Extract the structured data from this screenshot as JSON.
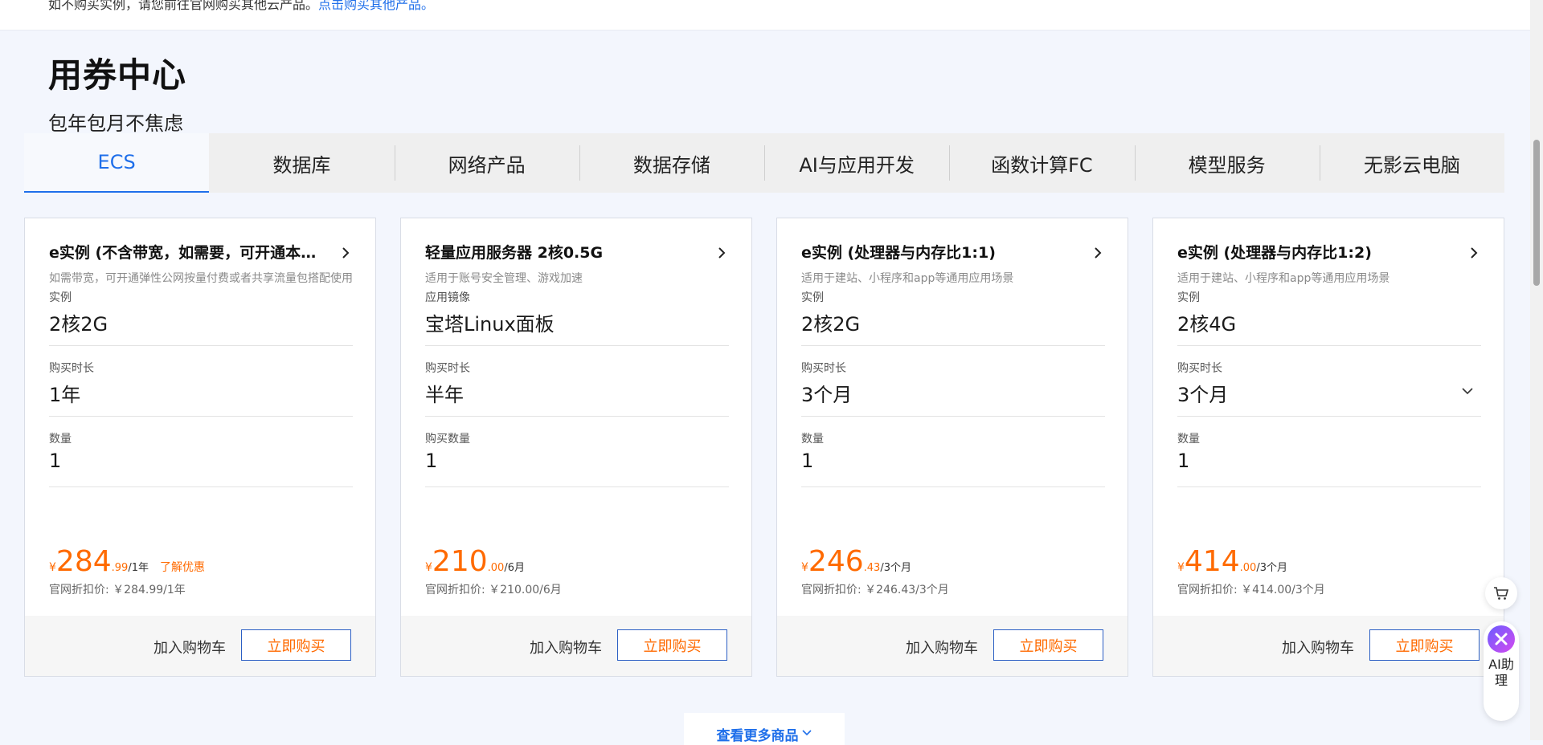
{
  "notice": {
    "text": "如不购买实例，请您前往官网购买其他云产品。",
    "link": "点击购买其他产品。"
  },
  "header": {
    "title": "用券中心",
    "subtitle": "包年包月不焦虑"
  },
  "tabs": [
    {
      "label": "ECS",
      "active": true
    },
    {
      "label": "数据库"
    },
    {
      "label": "网络产品"
    },
    {
      "label": "数据存储"
    },
    {
      "label": "AI与应用开发"
    },
    {
      "label": "函数计算FC"
    },
    {
      "label": "模型服务"
    },
    {
      "label": "无影云电脑"
    }
  ],
  "cards": [
    {
      "title": "e实例 (不含带宽，如需要，可开通本地公网)",
      "desc": "如需带宽，可开通弹性公网按量付费或者共享流量包搭配使用",
      "fields": [
        {
          "label": "实例",
          "value": "2核2G"
        },
        {
          "label": "购买时长",
          "value": "1年"
        },
        {
          "label": "数量",
          "value": "1"
        }
      ],
      "price": {
        "currency": "¥",
        "int": "284",
        "dec": ".99",
        "unit": "/1年"
      },
      "promo": "了解优惠",
      "ref_price": "官网折扣价: ￥284.99/1年",
      "add_cart": "加入购物车",
      "buy": "立即购买"
    },
    {
      "title": "轻量应用服务器 2核0.5G",
      "desc": "适用于账号安全管理、游戏加速",
      "fields": [
        {
          "label": "应用镜像",
          "value": "宝塔Linux面板"
        },
        {
          "label": "购买时长",
          "value": "半年"
        },
        {
          "label": "购买数量",
          "value": "1"
        }
      ],
      "price": {
        "currency": "¥",
        "int": "210",
        "dec": ".00",
        "unit": "/6月"
      },
      "ref_price": "官网折扣价: ￥210.00/6月",
      "add_cart": "加入购物车",
      "buy": "立即购买"
    },
    {
      "title": "e实例 (处理器与内存比1:1)",
      "desc": "适用于建站、小程序和app等通用应用场景",
      "fields": [
        {
          "label": "实例",
          "value": "2核2G"
        },
        {
          "label": "购买时长",
          "value": "3个月"
        },
        {
          "label": "数量",
          "value": "1"
        }
      ],
      "price": {
        "currency": "¥",
        "int": "246",
        "dec": ".43",
        "unit": "/3个月"
      },
      "ref_price": "官网折扣价: ￥246.43/3个月",
      "add_cart": "加入购物车",
      "buy": "立即购买"
    },
    {
      "title": "e实例 (处理器与内存比1:2)",
      "desc": "适用于建站、小程序和app等通用应用场景",
      "fields": [
        {
          "label": "实例",
          "value": "2核4G"
        },
        {
          "label": "购买时长",
          "value": "3个月",
          "dropdown": true
        },
        {
          "label": "数量",
          "value": "1"
        }
      ],
      "price": {
        "currency": "¥",
        "int": "414",
        "dec": ".00",
        "unit": "/3个月"
      },
      "ref_price": "官网折扣价: ￥414.00/3个月",
      "add_cart": "加入购物车",
      "buy": "立即购买"
    }
  ],
  "more_button": "查看更多商品",
  "ai_assistant": "AI助理",
  "icons": {
    "card_arrow": "chevron-right-icon",
    "dropdown": "chevron-down-icon",
    "more": "chevron-down-icon",
    "cart": "shopping-cart-icon",
    "ai": "sparkle-icon"
  },
  "colors": {
    "accent": "#1f6fea",
    "price": "#ff6a00",
    "button_border": "#2c5fc4",
    "background": "#f3f6fd"
  }
}
